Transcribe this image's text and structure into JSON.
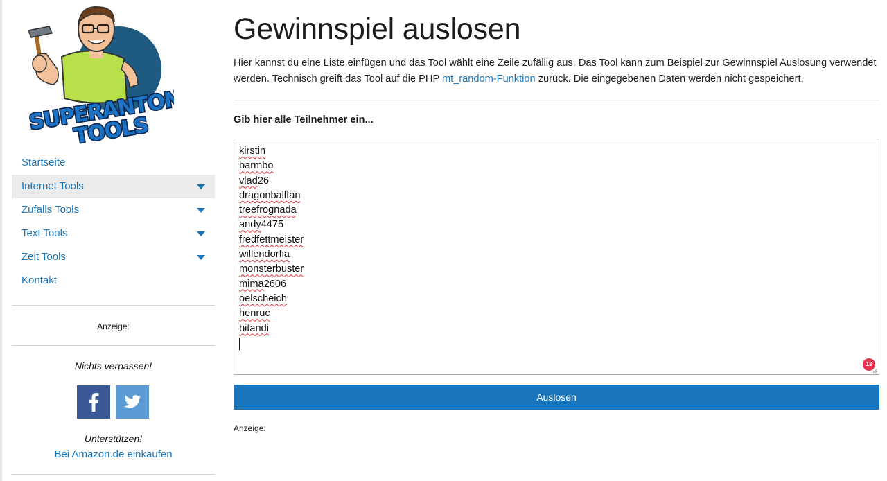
{
  "sidebar": {
    "logo": {
      "line1": "SUPERANTON",
      "line2": "TOOLS",
      "colors": {
        "circle": "#1f5a80",
        "shirt": "#b7e04a",
        "text_fill": "#1c72c4",
        "text_outline": "#0f2a52"
      }
    },
    "nav": [
      {
        "label": "Startseite",
        "has_dropdown": false,
        "active": false
      },
      {
        "label": "Internet Tools",
        "has_dropdown": true,
        "active": true
      },
      {
        "label": "Zufalls Tools",
        "has_dropdown": true,
        "active": false
      },
      {
        "label": "Text Tools",
        "has_dropdown": true,
        "active": false
      },
      {
        "label": "Zeit Tools",
        "has_dropdown": true,
        "active": false
      },
      {
        "label": "Kontakt",
        "has_dropdown": false,
        "active": false
      }
    ],
    "ad_label": "Anzeige:",
    "follow_title": "Nichts verpassen!",
    "social": [
      {
        "icon": "facebook-icon",
        "color": "#3b5998"
      },
      {
        "icon": "twitter-icon",
        "color": "#5b9bd5"
      }
    ],
    "support_title": "Unterstützen!",
    "amazon_link": "Bei Amazon.de einkaufen"
  },
  "main": {
    "title": "Gewinnspiel auslosen",
    "intro": {
      "before_link": "Hier kannst du eine Liste einfügen und das Tool wählt eine Zeile zufällig aus. Das Tool kann zum Beispiel zur Gewinnspiel Auslosung verwendet werden. Technisch greift das Tool auf die PHP ",
      "link": "mt_random-Funktion",
      "after_link": " zurück. Die eingegebenen Daten werden nicht gespeichert."
    },
    "field_label": "Gib hier alle Teilnehmer ein...",
    "entries": [
      {
        "flagged": "kirstin",
        "rest": ""
      },
      {
        "flagged": "barmbo",
        "rest": ""
      },
      {
        "flagged": "vlad",
        "rest": "26"
      },
      {
        "flagged": "dragonballfan",
        "rest": ""
      },
      {
        "flagged": "treefrognada",
        "rest": ""
      },
      {
        "flagged": "andy",
        "rest": "4475"
      },
      {
        "flagged": "fredfettmeister",
        "rest": ""
      },
      {
        "flagged": "willendorfia",
        "rest": ""
      },
      {
        "flagged": "monsterbuster",
        "rest": ""
      },
      {
        "flagged": "mima",
        "rest": "2606"
      },
      {
        "flagged": "oelscheich",
        "rest": ""
      },
      {
        "flagged": "henruc",
        "rest": ""
      },
      {
        "flagged": "bitandi",
        "rest": ""
      }
    ],
    "issue_count": "13",
    "submit_label": "Auslosen",
    "ad_label": "Anzeige:",
    "colors": {
      "link": "#1a76bc",
      "button": "#1a76bc",
      "badge": "#e8344e",
      "spell_underline": "#e0303a"
    }
  }
}
